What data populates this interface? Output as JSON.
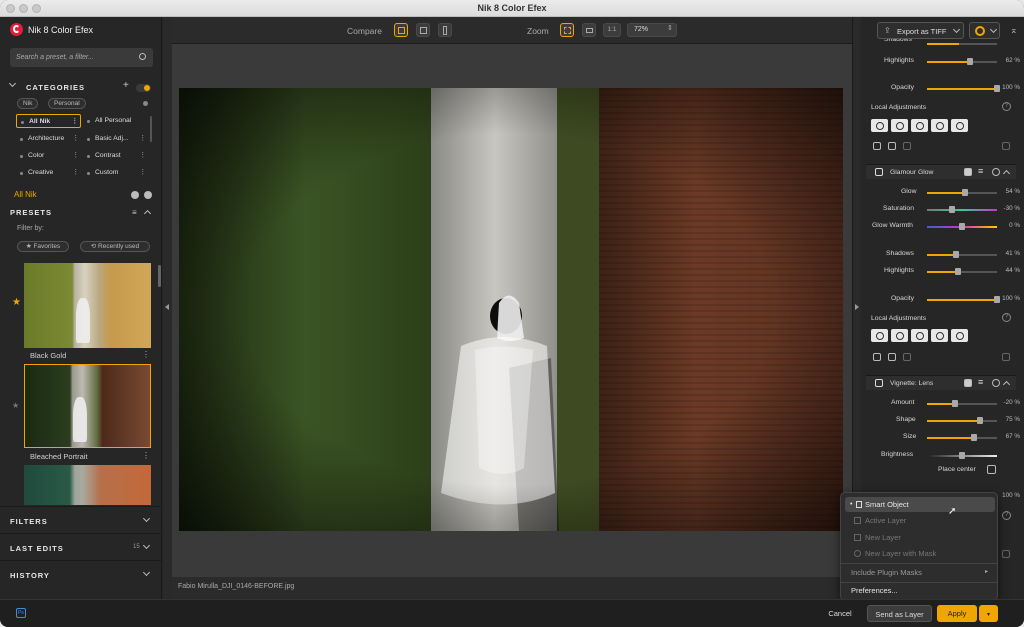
{
  "window": {
    "title": "Nik 8 Color Efex"
  },
  "app": {
    "name": "Nik 8 Color Efex"
  },
  "search": {
    "placeholder": "Search a preset, a filter..."
  },
  "categories": {
    "header": "CATEGORIES",
    "source_tabs": [
      "Nik",
      "Personal"
    ],
    "items": [
      "All Nik",
      "All Personal",
      "Architecture",
      "Basic Adj...",
      "Color",
      "Contrast",
      "Creative",
      "Custom"
    ]
  },
  "current_selection": "All Nik",
  "presets": {
    "header": "PRESETS",
    "filter_by": "Filter by:",
    "filter_buttons": [
      "Favorites",
      "Recently used"
    ],
    "items": [
      "Black Gold",
      "Bleached Portrait"
    ]
  },
  "sections": {
    "filters": "FILTERS",
    "last_edits": "LAST EDITS",
    "last_edits_count": "15",
    "history": "HISTORY"
  },
  "toolbar": {
    "compare_label": "Compare",
    "zoom_label": "Zoom",
    "zoom_one_to_one": "1:1",
    "zoom_value": "72%"
  },
  "image": {
    "filename": "Fabio Mirulla_DJI_0146-BEFORE.jpg"
  },
  "export": {
    "label": "Export as TIFF"
  },
  "adjustments_top": [
    {
      "label": "Shadows",
      "value": "",
      "level": 0.45
    },
    {
      "label": "Highlights",
      "value": "62 %",
      "level": 0.62
    },
    {
      "label": "Opacity",
      "value": "100 %",
      "level": 1.0
    }
  ],
  "local_adjustments_label": "Local Adjustments",
  "filters_panel": [
    {
      "name": "Glamour Glow",
      "params": [
        {
          "label": "Glow",
          "value": "54 %",
          "level": 0.54
        },
        {
          "label": "Saturation",
          "value": "-30 %",
          "level": 0.35
        },
        {
          "label": "Glow Warmth",
          "value": "0 %",
          "level": 0.5
        },
        {
          "label": "Shadows",
          "value": "41 %",
          "level": 0.41
        },
        {
          "label": "Highlights",
          "value": "44 %",
          "level": 0.44
        },
        {
          "label": "Opacity",
          "value": "100 %",
          "level": 1.0
        }
      ]
    },
    {
      "name": "Vignette: Lens",
      "params": [
        {
          "label": "Amount",
          "value": "-20 %",
          "level": 0.4
        },
        {
          "label": "Shape",
          "value": "75 %",
          "level": 0.75
        },
        {
          "label": "Size",
          "value": "67 %",
          "level": 0.67
        },
        {
          "label": "Brightness",
          "value": "",
          "level": 0.5
        }
      ],
      "place_center": "Place center"
    }
  ],
  "hidden_opacity_value": "100 %",
  "output_menu": {
    "items": [
      "Smart Object",
      "Active Layer",
      "New Layer",
      "New Layer with Mask",
      "Include Plugin Masks",
      "Preferences..."
    ],
    "selected": "Smart Object"
  },
  "footer": {
    "cancel": "Cancel",
    "send_as_layer": "Send as Layer",
    "apply": "Apply",
    "ps_badge": "Ps"
  },
  "colors": {
    "accent": "#f0a500",
    "panel": "#262626",
    "canvas": "#3a3a3a"
  }
}
